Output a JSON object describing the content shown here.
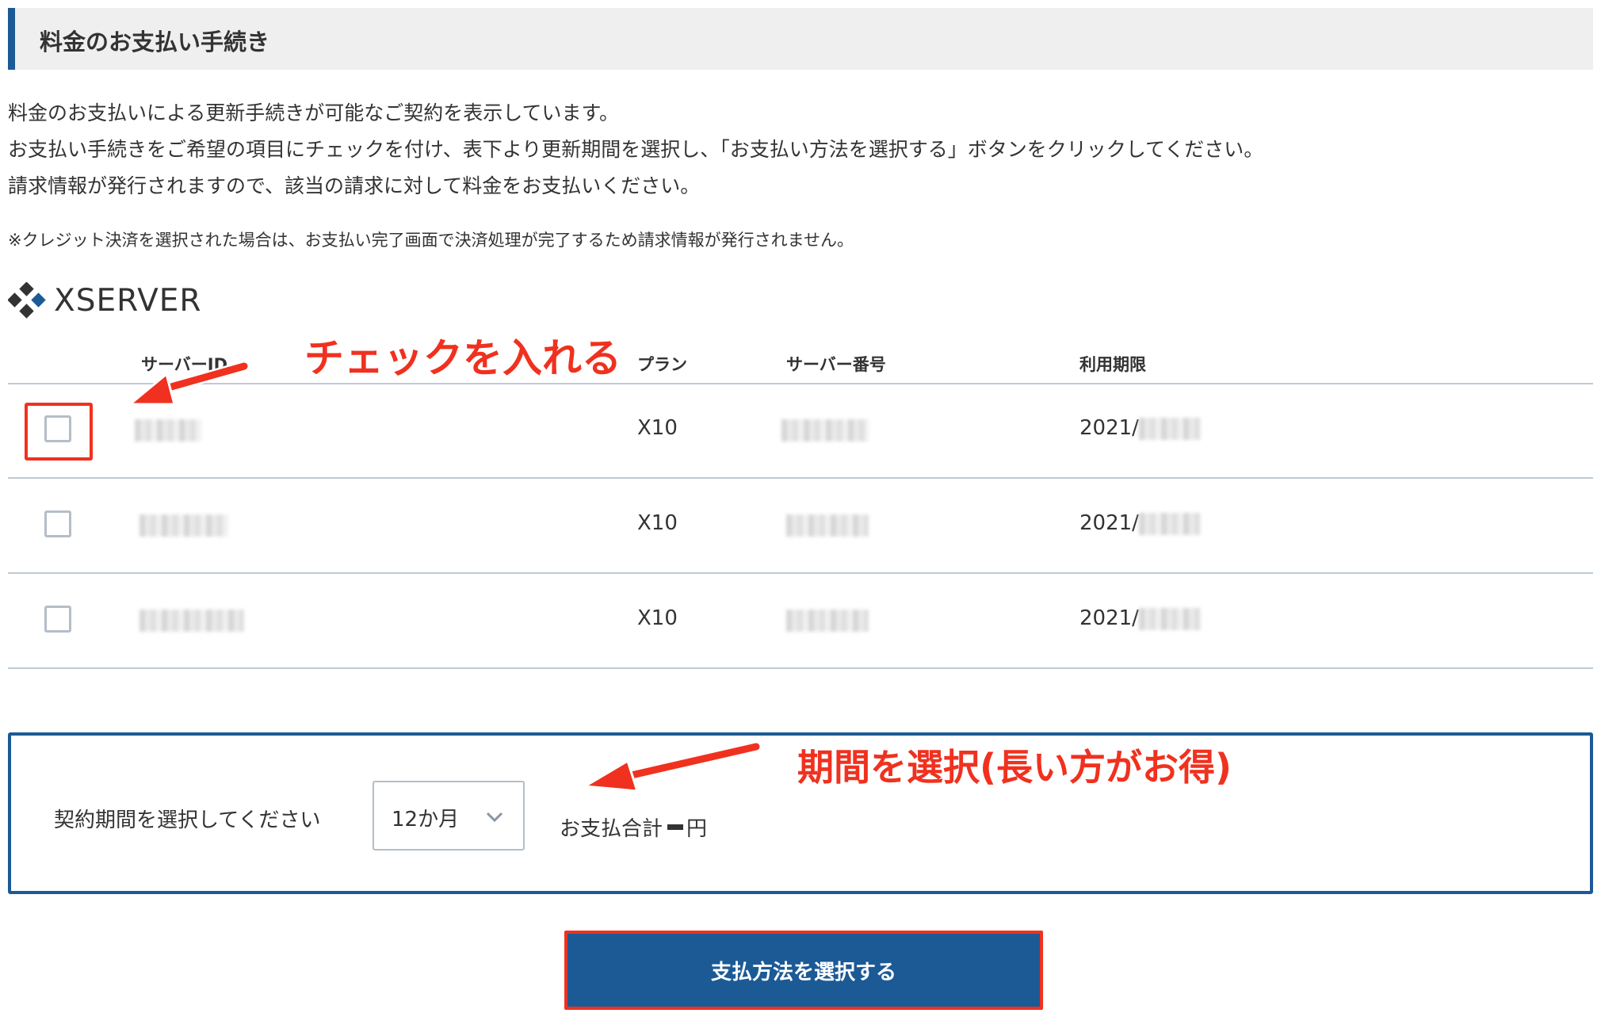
{
  "header": {
    "title": "料金のお支払い手続き"
  },
  "intro": {
    "lines": [
      "料金のお支払いによる更新手続きが可能なご契約を表示しています。",
      "お支払い手続きをご希望の項目にチェックを付け、表下より更新期間を選択し、「お支払い方法を選択する」ボタンをクリックしてください。",
      "請求情報が発行されますので、該当の請求に対して料金をお支払いください。"
    ],
    "note": "※クレジット決済を選択された場合は、お支払い完了画面で決済処理が完了するため請求情報が発行されません。"
  },
  "logo": {
    "text": "XSERVER",
    "icon": "xserver-diamond-logo",
    "color": "#333333"
  },
  "table": {
    "headers": {
      "server_id": "サーバーID",
      "plan": "プラン",
      "server_number": "サーバー番号",
      "expiry": "利用期限"
    },
    "rows": [
      {
        "checked": false,
        "plan": "X10",
        "expiry_prefix": "2021/"
      },
      {
        "checked": false,
        "plan": "X10",
        "expiry_prefix": "2021/"
      },
      {
        "checked": false,
        "plan": "X10",
        "expiry_prefix": "2021/"
      }
    ]
  },
  "period": {
    "label": "契約期間を選択してください",
    "selected": "12か月",
    "total_label": "お支払合計",
    "total_suffix": "円"
  },
  "pay_button": {
    "label": "支払方法を選択する"
  },
  "annotations": {
    "check": "チェックを入れる",
    "period": "期間を選択(長い方がお得)"
  },
  "colors": {
    "accent": "#1c5a96",
    "annotation": "#f0311f",
    "header_bg": "#efefef"
  }
}
